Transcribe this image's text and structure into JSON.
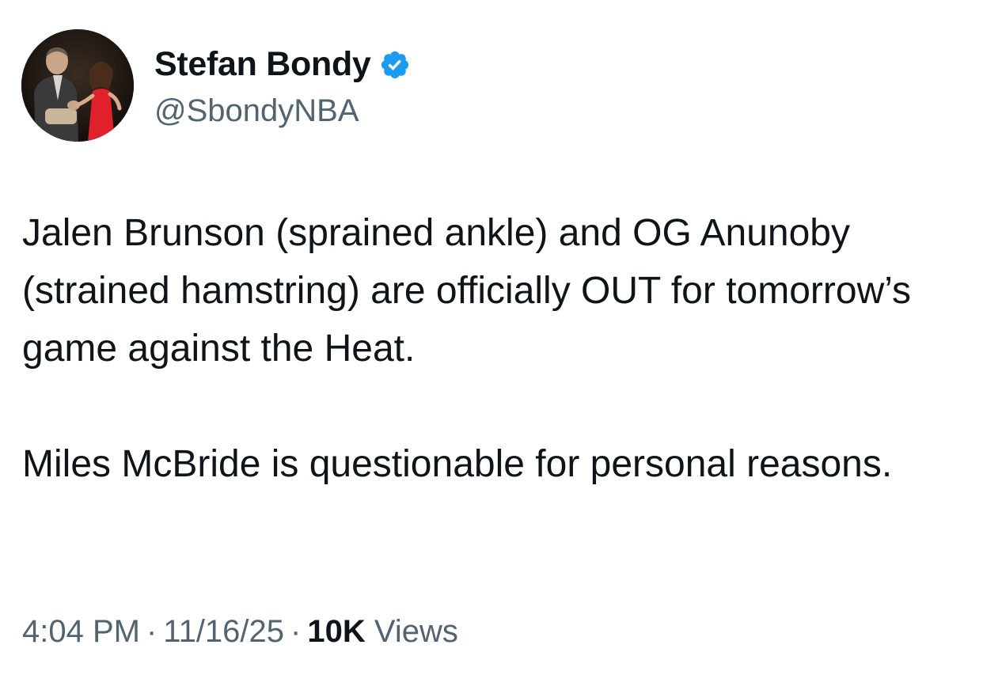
{
  "author": {
    "display_name": "Stefan Bondy",
    "handle": "@SbondyNBA",
    "verified": true,
    "verified_icon": "verified-badge-icon",
    "verified_color": "#1d9bf0"
  },
  "tweet": {
    "paragraphs": [
      "Jalen Brunson (sprained ankle) and OG Anunoby (strained hamstring) are officially OUT for tomorrow’s game against the Heat.",
      "Miles McBride is questionable for personal reasons."
    ]
  },
  "meta": {
    "time": "4:04 PM",
    "separator": "·",
    "date": "11/16/25",
    "views_count": "10K",
    "views_label": "Views"
  },
  "colors": {
    "text_primary": "#0f1419",
    "text_secondary": "#536471"
  }
}
